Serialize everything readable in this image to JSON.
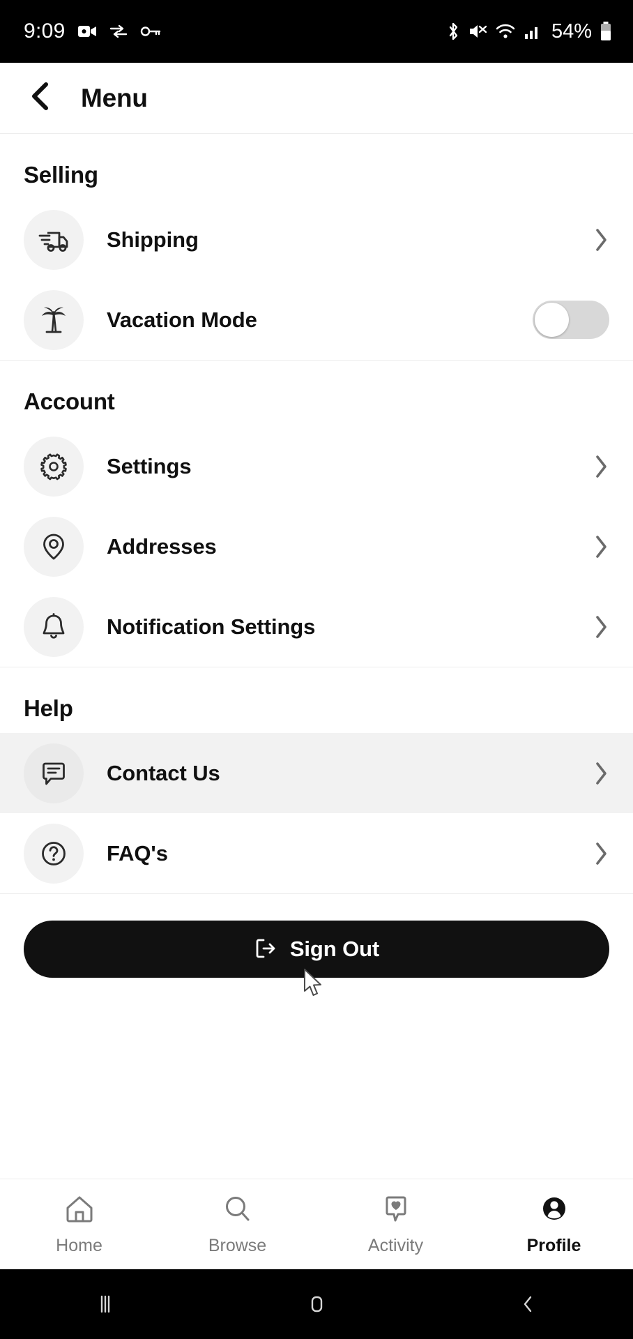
{
  "status_bar": {
    "time": "9:09",
    "battery_percent": "54%",
    "left_icons": [
      "video-camera-icon",
      "data-transfer-icon",
      "key-icon"
    ],
    "right_icons": [
      "bluetooth-icon",
      "volume-muted-icon",
      "wifi-icon",
      "cellular-signal-icon",
      "battery-icon"
    ]
  },
  "header": {
    "back_icon": "chevron-left-icon",
    "title": "Menu"
  },
  "sections": [
    {
      "title": "Selling",
      "rows": [
        {
          "label": "Shipping",
          "icon": "delivery-truck-icon",
          "control": "chevron",
          "highlighted": false
        },
        {
          "label": "Vacation Mode",
          "icon": "palm-tree-icon",
          "control": "toggle",
          "toggle_on": false,
          "highlighted": false
        }
      ]
    },
    {
      "title": "Account",
      "rows": [
        {
          "label": "Settings",
          "icon": "gear-icon",
          "control": "chevron",
          "highlighted": false
        },
        {
          "label": "Addresses",
          "icon": "map-pin-icon",
          "control": "chevron",
          "highlighted": false
        },
        {
          "label": "Notification Settings",
          "icon": "bell-icon",
          "control": "chevron",
          "highlighted": false
        }
      ]
    },
    {
      "title": "Help",
      "rows": [
        {
          "label": "Contact Us",
          "icon": "chat-bubble-icon",
          "control": "chevron",
          "highlighted": true
        },
        {
          "label": "FAQ's",
          "icon": "question-circle-icon",
          "control": "chevron",
          "highlighted": false
        }
      ]
    }
  ],
  "sign_out": {
    "label": "Sign Out",
    "icon": "logout-icon"
  },
  "bottom_nav": [
    {
      "label": "Home",
      "icon": "home-icon",
      "active": false
    },
    {
      "label": "Browse",
      "icon": "search-icon",
      "active": false
    },
    {
      "label": "Activity",
      "icon": "heart-bubble-icon",
      "active": false
    },
    {
      "label": "Profile",
      "icon": "person-icon",
      "active": true
    }
  ],
  "android_nav": [
    "recents-icon",
    "home-square-icon",
    "back-chevron-icon"
  ],
  "colors": {
    "accent": "#111111",
    "background": "#ffffff",
    "icon_circle": "#f2f2f2",
    "chevron": "#6b6b6b",
    "muted_text": "#7b7b7b",
    "divider": "#ededed",
    "toggle_track": "#d8d8d8"
  }
}
